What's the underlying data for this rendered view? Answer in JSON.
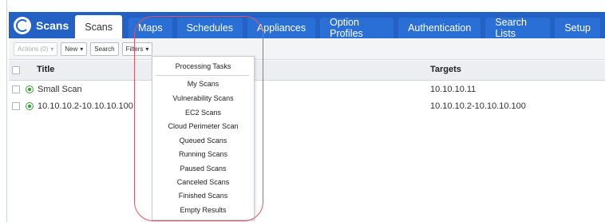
{
  "tabs": {
    "brand": "Scans",
    "items": [
      "Scans",
      "Maps",
      "Schedules",
      "Appliances",
      "Option Profiles",
      "Authentication",
      "Search Lists",
      "Setup"
    ]
  },
  "toolbar": {
    "actions_label": "Actions (0)",
    "new_label": "New",
    "search_label": "Search",
    "filters_label": "Filters"
  },
  "table": {
    "col_title": "Title",
    "col_targets": "Targets",
    "rows": [
      {
        "title": "Small Scan",
        "targets": "10.10.10.11"
      },
      {
        "title": "10.10.10.2-10.10.10.100",
        "targets": "10.10.10.2-10.10.10.100"
      }
    ]
  },
  "filters_menu": {
    "items": [
      "Processing Tasks",
      "My Scans",
      "Vulnerability Scans",
      "EC2 Scans",
      "Cloud Perimeter Scan",
      "Queued Scans",
      "Running Scans",
      "Paused Scans",
      "Canceled Scans",
      "Finished Scans",
      "Empty Results"
    ]
  },
  "colors": {
    "tab_bar": "#2461c4",
    "tab": "#2a6fd6",
    "highlight": "#e05565",
    "status_ok": "#3a9d3a"
  }
}
